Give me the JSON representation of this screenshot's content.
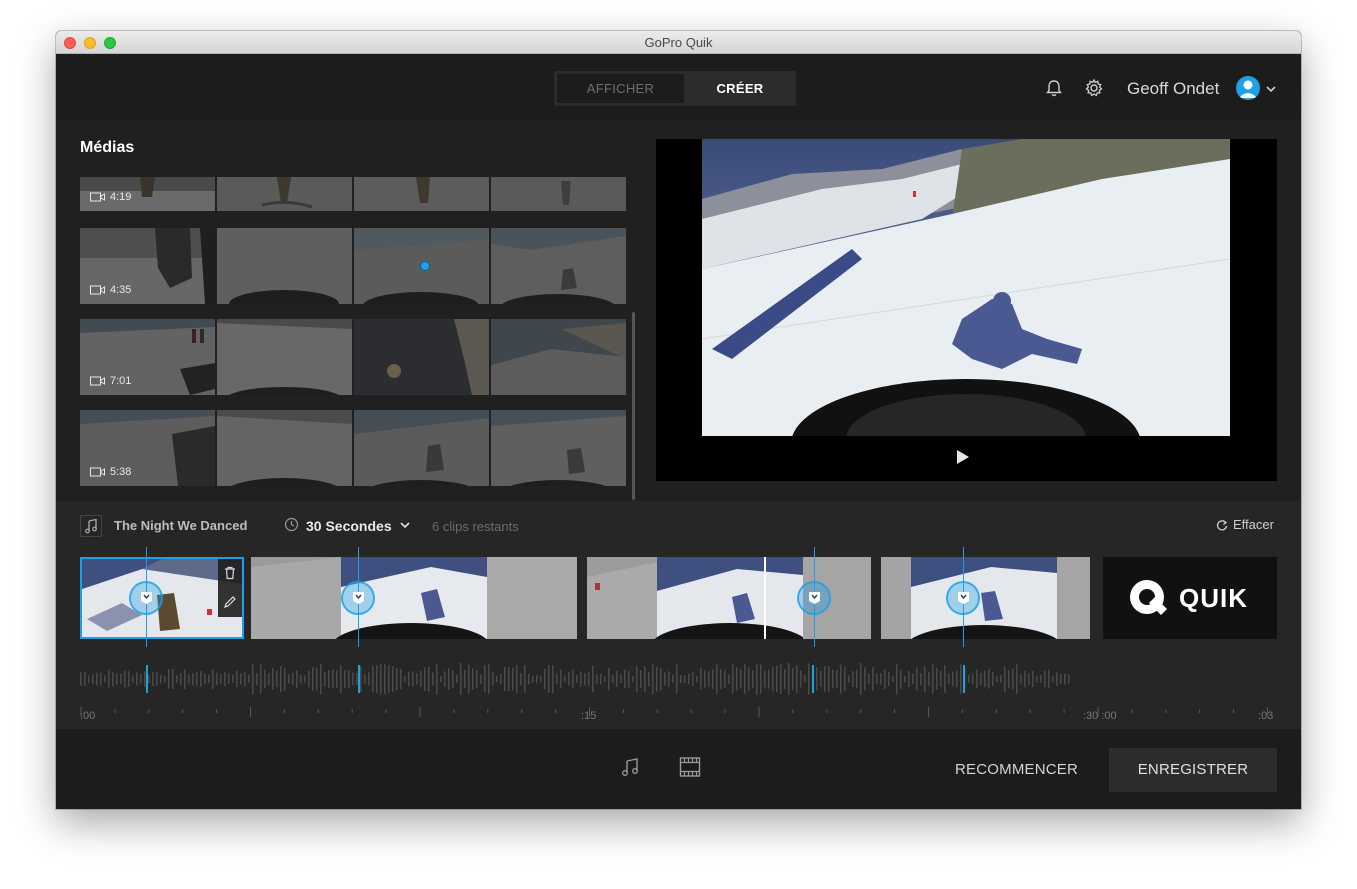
{
  "window": {
    "title": "GoPro Quik"
  },
  "topbar": {
    "tabs": [
      {
        "label": "AFFICHER"
      },
      {
        "label": "CRÉER"
      }
    ],
    "active_tab": "CRÉER",
    "user_name": "Geoff Ondet"
  },
  "media": {
    "title": "Médias",
    "rows": [
      {
        "duration": "4:19"
      },
      {
        "duration": "4:35"
      },
      {
        "duration": "7:01"
      },
      {
        "duration": "5:38"
      }
    ]
  },
  "timeline": {
    "song": "The Night We Danced",
    "duration": "30 Secondes",
    "clips_left": "6 clips restants",
    "clear_label": "Effacer",
    "logo_text": "QUIK",
    "ruler_labels": [
      ":00",
      ":15",
      ":30 :00",
      ":03"
    ]
  },
  "footer": {
    "restart_label": "RECOMMENCER",
    "save_label": "ENREGISTRER"
  },
  "colors": {
    "accent": "#1fa0e6",
    "background": "#1e1e1e",
    "panel": "#262626"
  }
}
